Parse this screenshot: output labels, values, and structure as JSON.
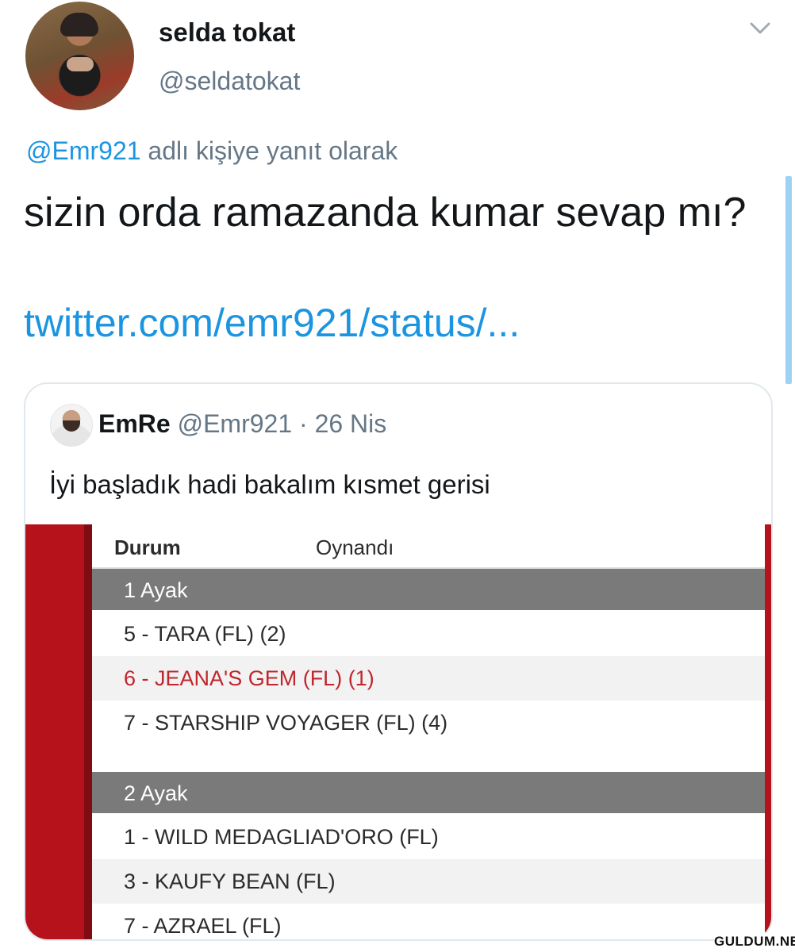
{
  "author": {
    "name": "selda tokat",
    "handle": "@seldatokat"
  },
  "reply": {
    "mention": "@Emr921",
    "suffix": " adlı kişiye yanıt olarak"
  },
  "tweet": {
    "text": "sizin orda ramazanda kumar sevap mı?",
    "link": "twitter.com/emr921/status/..."
  },
  "quote": {
    "name": "EmRe",
    "handle": "@Emr921",
    "date": " · 26 Nis",
    "text": "İyi başladık hadi bakalım kısmet gerisi",
    "table": {
      "col_status": "Durum",
      "col_played": "Oynandı",
      "sections": [
        {
          "title": "1 Ayak",
          "rows": [
            "5 - TARA (FL) (2)",
            "6 - JEANA'S GEM (FL) (1)",
            "7 - STARSHIP VOYAGER (FL) (4)"
          ]
        },
        {
          "title": "2 Ayak",
          "rows": [
            "1 - WILD MEDAGLIAD'ORO (FL)",
            "3 - KAUFY BEAN (FL)",
            "7 - AZRAEL (FL)"
          ]
        }
      ]
    }
  },
  "watermark": "GULDUM.NET",
  "colors": {
    "link": "#1b95e0",
    "winner": "#c0262d",
    "accent_red": "#b5121b"
  }
}
